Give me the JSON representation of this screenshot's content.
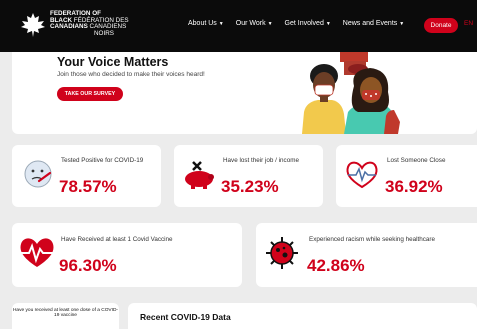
{
  "nav": {
    "logo_lines": [
      "FEDERATION OF",
      "BLACK",
      "FÉDÉRATION DES",
      "CANADIANS",
      "CANADIENS",
      "NOIRS"
    ],
    "menu": [
      "About Us",
      "Our Work",
      "Get Involved",
      "News and Events"
    ],
    "donate": "Donate",
    "lang": "EN"
  },
  "hero": {
    "title": "Your Voice Matters",
    "subtitle": "Join those who decided to make their voices heard!",
    "button": "TAKE OUR SURVEY"
  },
  "stats": [
    {
      "label": "Tested Positive for COVID-19",
      "value": "78.57%",
      "icon": "thermometer-face-icon"
    },
    {
      "label": "Have lost their job / income",
      "value": "35.23%",
      "icon": "piggy-bank-icon"
    },
    {
      "label": "Lost Someone Close",
      "value": "36.92%",
      "icon": "heartbeat-icon"
    },
    {
      "label": "Have Received at least 1 Covid Vaccine",
      "value": "96.30%",
      "icon": "heart-pulse-icon"
    },
    {
      "label": "Experienced racism while seeking healthcare",
      "value": "42.86%",
      "icon": "virus-icon"
    }
  ],
  "bottom": {
    "question": "Have you received at least one dose of a COVID-19 vaccine",
    "recent_title": "Recent COVID-19 Data"
  },
  "colors": {
    "accent": "#d0021b",
    "nav": "#0b0b0b"
  }
}
